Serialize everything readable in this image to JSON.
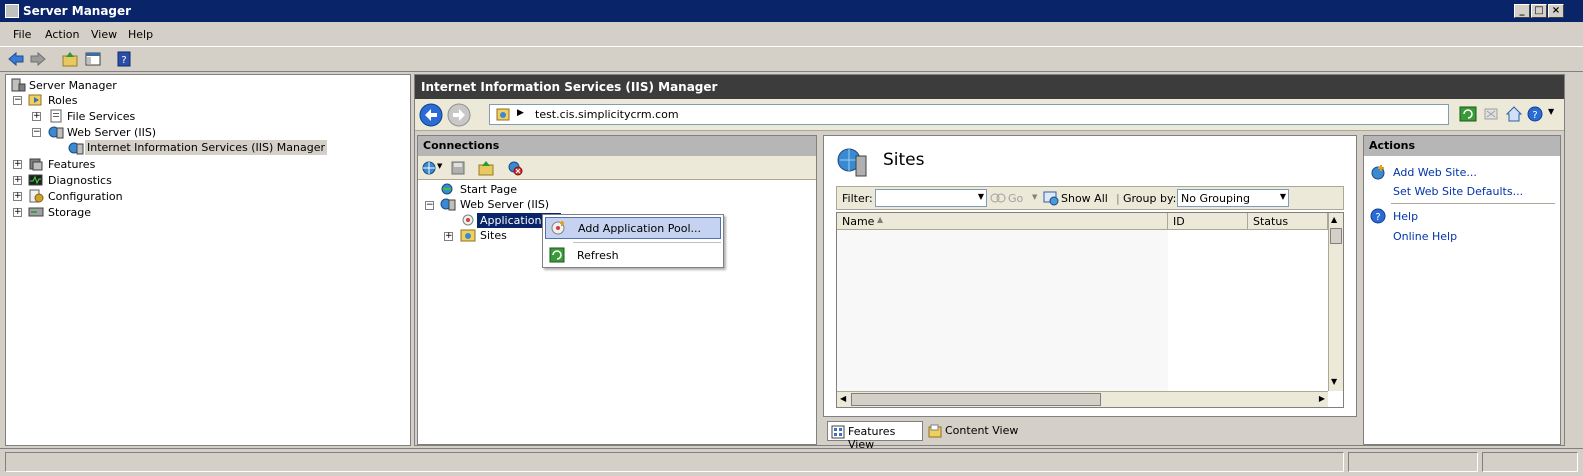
{
  "window": {
    "title": "Server Manager"
  },
  "menu": [
    "File",
    "Action",
    "View",
    "Help"
  ],
  "left_tree": {
    "root": "Server Manager",
    "roles": "Roles",
    "file_services": "File Services",
    "web_server": "Web Server (IIS)",
    "iis_manager": "Internet Information Services (IIS) Manager",
    "features": "Features",
    "diagnostics": "Diagnostics",
    "configuration": "Configuration",
    "storage": "Storage"
  },
  "iis": {
    "header": "Internet Information Services (IIS) Manager",
    "address": "test.cis.simplicitycrm.com"
  },
  "connections": {
    "title": "Connections",
    "start_page": "Start Page",
    "web_server": "Web Server (IIS)",
    "app_pools": "Application Po",
    "sites": "Sites"
  },
  "context_menu": {
    "add_pool": "Add Application Pool...",
    "refresh": "Refresh"
  },
  "sites_pane": {
    "title": "Sites",
    "filter_label": "Filter:",
    "go_label": "Go",
    "show_all": "Show All",
    "group_by_label": "Group by:",
    "group_by_value": "No Grouping",
    "columns": [
      "Name",
      "ID",
      "Status"
    ]
  },
  "views": {
    "features": "Features View",
    "content": "Content View"
  },
  "actions": {
    "title": "Actions",
    "add_web_site": "Add Web Site...",
    "set_defaults": "Set Web Site Defaults...",
    "help": "Help",
    "online_help": "Online Help"
  },
  "colors": {
    "title_bar": "#0a246a",
    "iis_header": "#3c3c3c",
    "selection": "#0a246a",
    "link": "#0033aa"
  }
}
